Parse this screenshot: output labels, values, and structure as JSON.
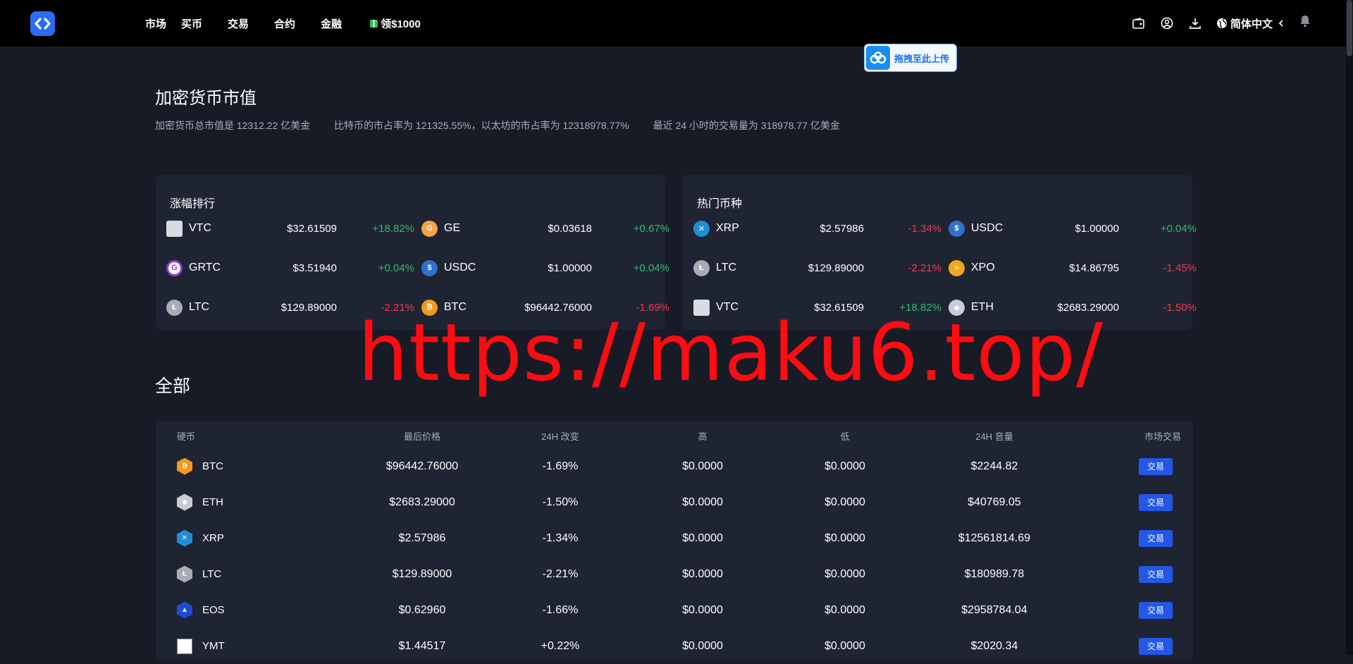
{
  "header": {
    "nav": [
      "市场",
      "买币",
      "交易",
      "合约",
      "金融"
    ],
    "promo": "领$1000",
    "language": "简体中文"
  },
  "upload": {
    "label": "拖拽至此上传"
  },
  "market": {
    "title": "加密货币市值",
    "summary": [
      "加密货币总市值是 12312.22 亿美金",
      "比特币的市占率为 121325.55%，以太坊的市占率为 12318978.77%",
      "最近 24 小时的交易量为 318978.77 亿美金"
    ]
  },
  "gainers": {
    "title": "涨幅排行",
    "items": [
      {
        "name": "VTC",
        "price": "$32.61509",
        "change": "+18.82%",
        "dir": "up",
        "icon": "broken-image-icon",
        "color": "#6b7a8f"
      },
      {
        "name": "GE",
        "price": "$0.03618",
        "change": "+0.67%",
        "dir": "up",
        "icon": "coin-ge-icon",
        "color": "#f3a34a"
      },
      {
        "name": "GRTC",
        "price": "$3.51940",
        "change": "+0.04%",
        "dir": "up",
        "icon": "coin-grtc-icon",
        "color": "#8a3ce0"
      },
      {
        "name": "USDC",
        "price": "$1.00000",
        "change": "+0.04%",
        "dir": "up",
        "icon": "coin-usdc-icon",
        "color": "#2f71cc"
      },
      {
        "name": "LTC",
        "price": "$129.89000",
        "change": "-2.21%",
        "dir": "down",
        "icon": "coin-ltc-icon",
        "color": "#a9acb3"
      },
      {
        "name": "BTC",
        "price": "$96442.76000",
        "change": "-1.69%",
        "dir": "down",
        "icon": "coin-btc-icon",
        "color": "#f39a1c"
      }
    ]
  },
  "hot": {
    "title": "热门币种",
    "items": [
      {
        "name": "XRP",
        "price": "$2.57986",
        "change": "-1.34%",
        "dir": "down",
        "icon": "coin-xrp-icon",
        "color": "#1f8fd4"
      },
      {
        "name": "USDC",
        "price": "$1.00000",
        "change": "+0.04%",
        "dir": "up",
        "icon": "coin-usdc-icon",
        "color": "#2f71cc"
      },
      {
        "name": "LTC",
        "price": "$129.89000",
        "change": "-2.21%",
        "dir": "down",
        "icon": "coin-ltc-icon",
        "color": "#a9acb3"
      },
      {
        "name": "XPO",
        "price": "$14.86795",
        "change": "-1.45%",
        "dir": "down",
        "icon": "coin-xpo-icon",
        "color": "#f4a71c"
      },
      {
        "name": "VTC",
        "price": "$32.61509",
        "change": "+18.82%",
        "dir": "up",
        "icon": "broken-image-icon",
        "color": "#6b7a8f"
      },
      {
        "name": "ETH",
        "price": "$2683.29000",
        "change": "-1.50%",
        "dir": "down",
        "icon": "coin-eth-icon",
        "color": "#c9ccd6"
      }
    ]
  },
  "all": {
    "title": "全部",
    "columns": [
      "硬币",
      "最后价格",
      "24H 改变",
      "高",
      "低",
      "24H 音量",
      "市场交易"
    ],
    "trade_label": "交易",
    "rows": [
      {
        "coin": "BTC",
        "price": "$96442.76000",
        "change": "-1.69%",
        "dir": "down",
        "high": "$0.0000",
        "low": "$0.0000",
        "volume": "$2244.82",
        "icon": "coin-btc-icon",
        "color": "#f39a1c"
      },
      {
        "coin": "ETH",
        "price": "$2683.29000",
        "change": "-1.50%",
        "dir": "down",
        "high": "$0.0000",
        "low": "$0.0000",
        "volume": "$40769.05",
        "icon": "coin-eth-icon",
        "color": "#c9ccd6"
      },
      {
        "coin": "XRP",
        "price": "$2.57986",
        "change": "-1.34%",
        "dir": "down",
        "high": "$0.0000",
        "low": "$0.0000",
        "volume": "$12561814.69",
        "icon": "coin-xrp-icon",
        "color": "#1f8fd4"
      },
      {
        "coin": "LTC",
        "price": "$129.89000",
        "change": "-2.21%",
        "dir": "down",
        "high": "$0.0000",
        "low": "$0.0000",
        "volume": "$180989.78",
        "icon": "coin-ltc-icon",
        "color": "#a9acb3"
      },
      {
        "coin": "EOS",
        "price": "$0.62960",
        "change": "-1.66%",
        "dir": "down",
        "high": "$0.0000",
        "low": "$0.0000",
        "volume": "$2958784.04",
        "icon": "coin-eos-icon",
        "color": "#1f49d8"
      },
      {
        "coin": "YMT",
        "price": "$1.44517",
        "change": "+0.22%",
        "dir": "up",
        "high": "$0.0000",
        "low": "$0.0000",
        "volume": "$2020.34",
        "icon": "broken-image-icon",
        "color": "#ffffff"
      }
    ]
  },
  "watermark": "https://maku6.top/"
}
